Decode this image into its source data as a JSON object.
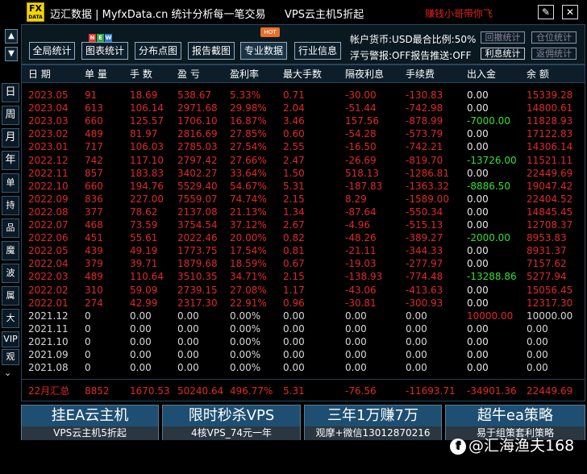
{
  "titlebar": {
    "title": "迈汇数据 | MyfxData.cn  统计分析每一笔交易",
    "vps_link": "VPS云主机5折起",
    "promo": "赚钱小哥带你飞",
    "edit_icon": "✎",
    "close_icon": "✕",
    "logo_top": "FX",
    "logo_bottom": "DATA"
  },
  "left_tabs": [
    {
      "label": "日"
    },
    {
      "label": "周"
    },
    {
      "label": "月"
    },
    {
      "label": "年"
    },
    {
      "label": "单币"
    },
    {
      "label": "持仓"
    },
    {
      "label": "品种"
    },
    {
      "label": "魔号"
    },
    {
      "label": "波幅"
    },
    {
      "label": "属性"
    },
    {
      "label": "大字"
    },
    {
      "label": "VIP"
    },
    {
      "label": "观摩"
    }
  ],
  "left_more": "⌄",
  "arrows": {
    "up": "▲",
    "down": "▼"
  },
  "toolbar": {
    "buttons": [
      {
        "label": "全局统计"
      },
      {
        "label": "图表统计"
      },
      {
        "label": "分布点图"
      },
      {
        "label": "报告截图"
      },
      {
        "label": "专业数据"
      },
      {
        "label": "行业信息"
      }
    ],
    "hot_badge": "HOT",
    "new_badge": [
      "N",
      "E",
      "W"
    ],
    "account_line": "帐户货币:USD最合比例:50%",
    "alert_line": "浮亏警报:OFF报告推送:OFF",
    "small_buttons": [
      {
        "label": "回撤统计"
      },
      {
        "label": "仓位统计"
      },
      {
        "label": "利息统计"
      },
      {
        "label": "返佣统计"
      }
    ]
  },
  "table": {
    "headers": [
      "日 期",
      "单 量",
      "手 数",
      "盈 亏",
      "盈利率",
      "最大手数",
      "隔夜利息",
      "手续费",
      "出入金",
      "余 额"
    ],
    "rows": [
      [
        "2023.05",
        "91",
        "18.69",
        "538.67",
        "5.33%",
        "0.71",
        "-30.00",
        "-130.83",
        "0.00",
        "15339.28"
      ],
      [
        "2023.04",
        "613",
        "106.14",
        "2971.68",
        "29.98%",
        "2.04",
        "-51.44",
        "-742.98",
        "0.00",
        "14800.61"
      ],
      [
        "2023.03",
        "660",
        "125.57",
        "1706.10",
        "16.87%",
        "3.46",
        "157.56",
        "-878.99",
        "-7000.00",
        "11828.93"
      ],
      [
        "2023.02",
        "489",
        "81.97",
        "2816.69",
        "27.85%",
        "0.60",
        "-54.28",
        "-573.79",
        "0.00",
        "17122.83"
      ],
      [
        "2023.01",
        "717",
        "106.03",
        "2785.03",
        "27.54%",
        "2.55",
        "-16.50",
        "-742.21",
        "0.00",
        "14306.14"
      ],
      [
        "2022.12",
        "742",
        "117.10",
        "2797.42",
        "27.66%",
        "2.47",
        "-26.69",
        "-819.70",
        "-13726.00",
        "11521.11"
      ],
      [
        "2022.11",
        "857",
        "183.83",
        "3402.27",
        "33.64%",
        "1.50",
        "518.13",
        "-1286.81",
        "0.00",
        "22449.69"
      ],
      [
        "2022.10",
        "660",
        "194.76",
        "5529.40",
        "54.67%",
        "5.31",
        "-187.83",
        "-1363.32",
        "-8886.50",
        "19047.42"
      ],
      [
        "2022.09",
        "836",
        "227.00",
        "7559.07",
        "74.74%",
        "2.15",
        "8.29",
        "-1589.00",
        "0.00",
        "22404.52"
      ],
      [
        "2022.08",
        "377",
        "78.62",
        "2137.08",
        "21.13%",
        "1.34",
        "-87.64",
        "-550.34",
        "0.00",
        "14845.45"
      ],
      [
        "2022.07",
        "468",
        "73.59",
        "3754.54",
        "37.12%",
        "2.67",
        "-4.96",
        "-515.13",
        "0.00",
        "12708.37"
      ],
      [
        "2022.06",
        "451",
        "55.61",
        "2022.46",
        "20.00%",
        "0.82",
        "-48.26",
        "-389.27",
        "-2000.00",
        "8953.83"
      ],
      [
        "2022.05",
        "439",
        "49.19",
        "1773.75",
        "17.54%",
        "0.81",
        "-21.11",
        "-344.33",
        "0.00",
        "8931.37"
      ],
      [
        "2022.04",
        "379",
        "39.71",
        "1879.68",
        "18.59%",
        "0.67",
        "-19.03",
        "-277.97",
        "0.00",
        "7157.62"
      ],
      [
        "2022.03",
        "489",
        "110.64",
        "3510.35",
        "34.71%",
        "2.15",
        "-138.93",
        "-774.48",
        "-13288.86",
        "5277.94"
      ],
      [
        "2022.02",
        "310",
        "59.09",
        "2739.15",
        "27.08%",
        "1.17",
        "-43.06",
        "-413.63",
        "0.00",
        "15056.45"
      ],
      [
        "2022.01",
        "274",
        "42.99",
        "2317.30",
        "22.91%",
        "0.96",
        "-30.81",
        "-300.93",
        "0.00",
        "12317.30"
      ],
      [
        "2021.12",
        "0",
        "0.00",
        "0.00",
        "0.00%",
        "0.00",
        "0.00",
        "0.00",
        "10000.00",
        "10000.00"
      ],
      [
        "2021.11",
        "0",
        "0.00",
        "0.00",
        "0.00%",
        "0.00",
        "0.00",
        "0.00",
        "0.00",
        "0.00"
      ],
      [
        "2021.10",
        "0",
        "0.00",
        "0.00",
        "0.00%",
        "0.00",
        "0.00",
        "0.00",
        "0.00",
        "0.00"
      ],
      [
        "2021.09",
        "0",
        "0.00",
        "0.00",
        "0.00%",
        "0.00",
        "0.00",
        "0.00",
        "0.00",
        "0.00"
      ],
      [
        "2021.08",
        "0",
        "0.00",
        "0.00",
        "0.00%",
        "0.00",
        "0.00",
        "0.00",
        "0.00",
        "0.00"
      ]
    ],
    "summary": [
      "22月汇总",
      "8852",
      "1670.53",
      "50240.64",
      "496.77%",
      "5.31",
      "-76.56",
      "-11693.71",
      "-34901.36",
      "22449.69"
    ]
  },
  "ads": [
    {
      "top": "挂EA云主机",
      "bottom": "VPS云主机5折起"
    },
    {
      "top": "限时秒杀VPS",
      "bottom": "4核VPS_74元一年"
    },
    {
      "top": "三年1万赚7万",
      "bottom": "观摩+微信13012870216"
    },
    {
      "top": "超牛ea策略",
      "bottom": "易于组策套利策略"
    }
  ],
  "watermark": {
    "icon": "f",
    "text": "@汇海渔夫168"
  },
  "colors": {
    "profit": "#e02828",
    "loss": "#34e034",
    "header_bg": "#0d1d2a",
    "ad_bg": "#1e4f72"
  }
}
